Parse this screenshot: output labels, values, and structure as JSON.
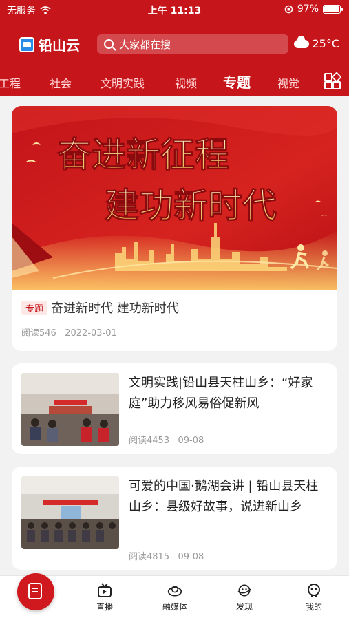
{
  "status": {
    "carrier": "无服务",
    "time": "上午 11:13",
    "battery": "97%"
  },
  "header": {
    "app_name": "铅山云",
    "search_placeholder": "大家都在搜",
    "temperature": "25°C",
    "weather_icon": "cloud-icon"
  },
  "tabs": [
    {
      "label": "工程"
    },
    {
      "label": "社会"
    },
    {
      "label": "文明实践"
    },
    {
      "label": "视频"
    },
    {
      "label": "专题",
      "active": true
    },
    {
      "label": "视觉"
    }
  ],
  "featured": {
    "banner_line1": "奋进新征程",
    "banner_line2": "建功新时代",
    "tag": "专题",
    "title": "奋进新时代  建功新时代",
    "reads": "阅读546",
    "date": "2022-03-01"
  },
  "news": [
    {
      "title": "文明实践|铅山县天柱山乡：“好家庭”助力移风易俗促新风",
      "reads": "阅读4453",
      "date": "09-08"
    },
    {
      "title": "可爱的中国·鹅湖会讲 | 铅山县天柱山乡：县级好故事，说进新山乡",
      "reads": "阅读4815",
      "date": "09-08"
    }
  ],
  "bottom_nav": [
    {
      "label": "",
      "icon": "home-news-icon"
    },
    {
      "label": "直播",
      "icon": "tv-icon"
    },
    {
      "label": "融媒体",
      "icon": "media-icon"
    },
    {
      "label": "发现",
      "icon": "discover-icon"
    },
    {
      "label": "我的",
      "icon": "profile-icon"
    }
  ],
  "colors": {
    "brand_red": "#c7161b",
    "gold": "#f6d98a"
  }
}
